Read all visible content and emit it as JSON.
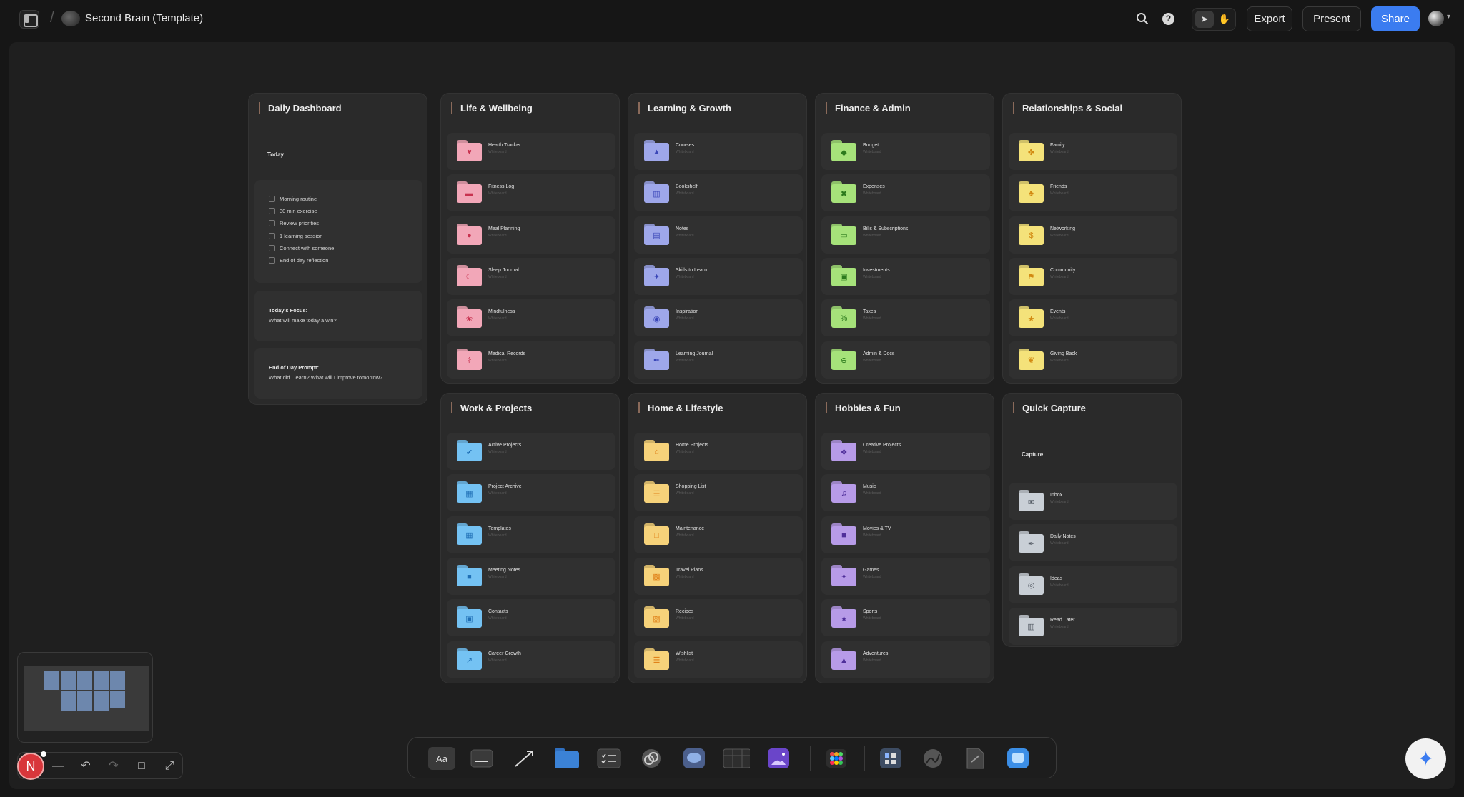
{
  "header": {
    "title": "Second Brain (Template)",
    "export_label": "Export",
    "present_label": "Present",
    "share_label": "Share"
  },
  "dashboard": {
    "title": "Daily Dashboard",
    "today_label": "Today",
    "checklist": [
      "Morning routine",
      "30 min exercise",
      "Review priorities",
      "1 learning session",
      "Connect with someone",
      "End of day reflection"
    ],
    "focus_label": "Today's Focus:",
    "focus_text": "What will make today a win?",
    "prompt_label": "End of Day Prompt:",
    "prompt_text": "What did I learn? What will I improve tomorrow?"
  },
  "boards": [
    {
      "title": "Life & Wellbeing",
      "color": "#f2a7b8",
      "ink": "#c8324f",
      "items": [
        {
          "name": "Health Tracker",
          "sub": "Whiteboard",
          "icon": "heart-icon"
        },
        {
          "name": "Fitness Log",
          "sub": "Whiteboard",
          "icon": "dumbbell-icon"
        },
        {
          "name": "Meal Planning",
          "sub": "Whiteboard",
          "icon": "apple-icon"
        },
        {
          "name": "Sleep Journal",
          "sub": "Whiteboard",
          "icon": "moon-icon"
        },
        {
          "name": "Mindfulness",
          "sub": "Whiteboard",
          "icon": "lotus-icon"
        },
        {
          "name": "Medical Records",
          "sub": "Whiteboard",
          "icon": "stethoscope-icon"
        }
      ]
    },
    {
      "title": "Learning & Growth",
      "color": "#9ea7ea",
      "ink": "#3a46b8",
      "items": [
        {
          "name": "Courses",
          "sub": "Whiteboard",
          "icon": "graduation-cap-icon"
        },
        {
          "name": "Bookshelf",
          "sub": "Whiteboard",
          "icon": "book-icon"
        },
        {
          "name": "Notes",
          "sub": "Whiteboard",
          "icon": "note-icon"
        },
        {
          "name": "Skills to Learn",
          "sub": "Whiteboard",
          "icon": "sparkle-icon"
        },
        {
          "name": "Inspiration",
          "sub": "Whiteboard",
          "icon": "eye-icon"
        },
        {
          "name": "Learning Journal",
          "sub": "Whiteboard",
          "icon": "feather-icon"
        }
      ]
    },
    {
      "title": "Finance & Admin",
      "color": "#a6e27a",
      "ink": "#2c7a1d",
      "items": [
        {
          "name": "Budget",
          "sub": "Whiteboard",
          "icon": "money-bag-icon"
        },
        {
          "name": "Expenses",
          "sub": "Whiteboard",
          "icon": "receipt-icon"
        },
        {
          "name": "Bills & Subscriptions",
          "sub": "Whiteboard",
          "icon": "credit-card-icon"
        },
        {
          "name": "Investments",
          "sub": "Whiteboard",
          "icon": "banknote-icon"
        },
        {
          "name": "Taxes",
          "sub": "Whiteboard",
          "icon": "percent-icon"
        },
        {
          "name": "Admin & Docs",
          "sub": "Whiteboard",
          "icon": "globe-icon"
        }
      ]
    },
    {
      "title": "Relationships & Social",
      "color": "#f4e27a",
      "ink": "#d28a12",
      "items": [
        {
          "name": "Family",
          "sub": "Whiteboard",
          "icon": "family-icon"
        },
        {
          "name": "Friends",
          "sub": "Whiteboard",
          "icon": "people-icon"
        },
        {
          "name": "Networking",
          "sub": "Whiteboard",
          "icon": "network-icon"
        },
        {
          "name": "Community",
          "sub": "Whiteboard",
          "icon": "community-icon"
        },
        {
          "name": "Events",
          "sub": "Whiteboard",
          "icon": "party-icon"
        },
        {
          "name": "Giving Back",
          "sub": "Whiteboard",
          "icon": "hands-icon"
        }
      ]
    },
    {
      "title": "Work & Projects",
      "color": "#74c2f3",
      "ink": "#1f6fb5",
      "items": [
        {
          "name": "Active Projects",
          "sub": "Whiteboard",
          "icon": "check-circle-icon"
        },
        {
          "name": "Project Archive",
          "sub": "Whiteboard",
          "icon": "archive-icon"
        },
        {
          "name": "Templates",
          "sub": "Whiteboard",
          "icon": "grid-icon"
        },
        {
          "name": "Meeting Notes",
          "sub": "Whiteboard",
          "icon": "chat-icon"
        },
        {
          "name": "Contacts",
          "sub": "Whiteboard",
          "icon": "contact-card-icon"
        },
        {
          "name": "Career Growth",
          "sub": "Whiteboard",
          "icon": "chart-up-icon"
        }
      ]
    },
    {
      "title": "Home & Lifestyle",
      "color": "#f6d27a",
      "ink": "#e0821a",
      "items": [
        {
          "name": "Home Projects",
          "sub": "Whiteboard",
          "icon": "house-icon"
        },
        {
          "name": "Shopping List",
          "sub": "Whiteboard",
          "icon": "list-icon"
        },
        {
          "name": "Maintenance",
          "sub": "Whiteboard",
          "icon": "wrench-icon"
        },
        {
          "name": "Travel Plans",
          "sub": "Whiteboard",
          "icon": "suitcase-icon"
        },
        {
          "name": "Recipes",
          "sub": "Whiteboard",
          "icon": "recipe-icon"
        },
        {
          "name": "Wishlist",
          "sub": "Whiteboard",
          "icon": "wish-list-icon"
        }
      ]
    },
    {
      "title": "Hobbies & Fun",
      "color": "#b79be8",
      "ink": "#4f2f9a",
      "items": [
        {
          "name": "Creative Projects",
          "sub": "Whiteboard",
          "icon": "palette-icon"
        },
        {
          "name": "Music",
          "sub": "Whiteboard",
          "icon": "music-icon"
        },
        {
          "name": "Movies & TV",
          "sub": "Whiteboard",
          "icon": "tv-icon"
        },
        {
          "name": "Games",
          "sub": "Whiteboard",
          "icon": "gamepad-icon"
        },
        {
          "name": "Sports",
          "sub": "Whiteboard",
          "icon": "runner-icon"
        },
        {
          "name": "Adventures",
          "sub": "Whiteboard",
          "icon": "mountain-icon"
        }
      ]
    }
  ],
  "quick_capture": {
    "title": "Quick Capture",
    "capture_label": "Capture",
    "color": "#c9cfd6",
    "ink": "#555c66",
    "items": [
      {
        "name": "Inbox",
        "sub": "Whiteboard",
        "icon": "inbox-icon"
      },
      {
        "name": "Daily Notes",
        "sub": "Whiteboard",
        "icon": "feather-icon"
      },
      {
        "name": "Ideas",
        "sub": "Whiteboard",
        "icon": "lightbulb-icon"
      },
      {
        "name": "Read Later",
        "sub": "Whiteboard",
        "icon": "open-book-icon"
      }
    ]
  },
  "user": {
    "initial": "N"
  },
  "toolbar": {
    "text_tool_label": "Aa"
  },
  "colors": {
    "accent": "#3b7cf0",
    "avatar": "#d8363b"
  }
}
